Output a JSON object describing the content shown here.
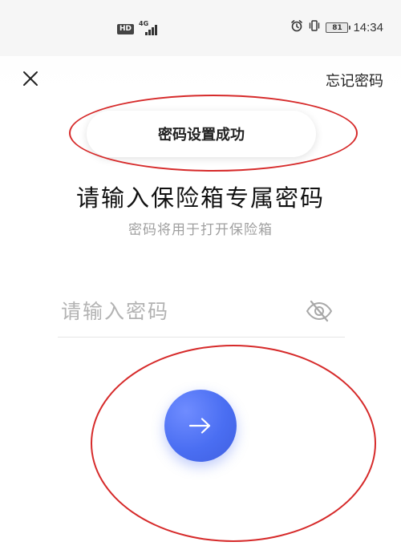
{
  "status_bar": {
    "hd_label": "HD",
    "network_type": "4G",
    "battery_level": "81",
    "time": "14:34",
    "icons": [
      "alarm-icon",
      "vibrate-icon",
      "battery-icon"
    ]
  },
  "header": {
    "close_icon": "close-icon",
    "forgot_password_label": "忘记密码"
  },
  "toast": {
    "message": "密码设置成功"
  },
  "main": {
    "title": "请输入保险箱专属密码",
    "subtitle": "密码将用于打开保险箱",
    "password_field": {
      "value": "",
      "placeholder": "请输入密码",
      "visibility_icon": "eye-off-icon"
    },
    "next_button_icon": "arrow-right-icon"
  },
  "colors": {
    "accent": "#4a6ef2",
    "annotation_ring": "#d62a2a",
    "placeholder": "#b3b3b3",
    "subtitle": "#a0a0a0"
  }
}
